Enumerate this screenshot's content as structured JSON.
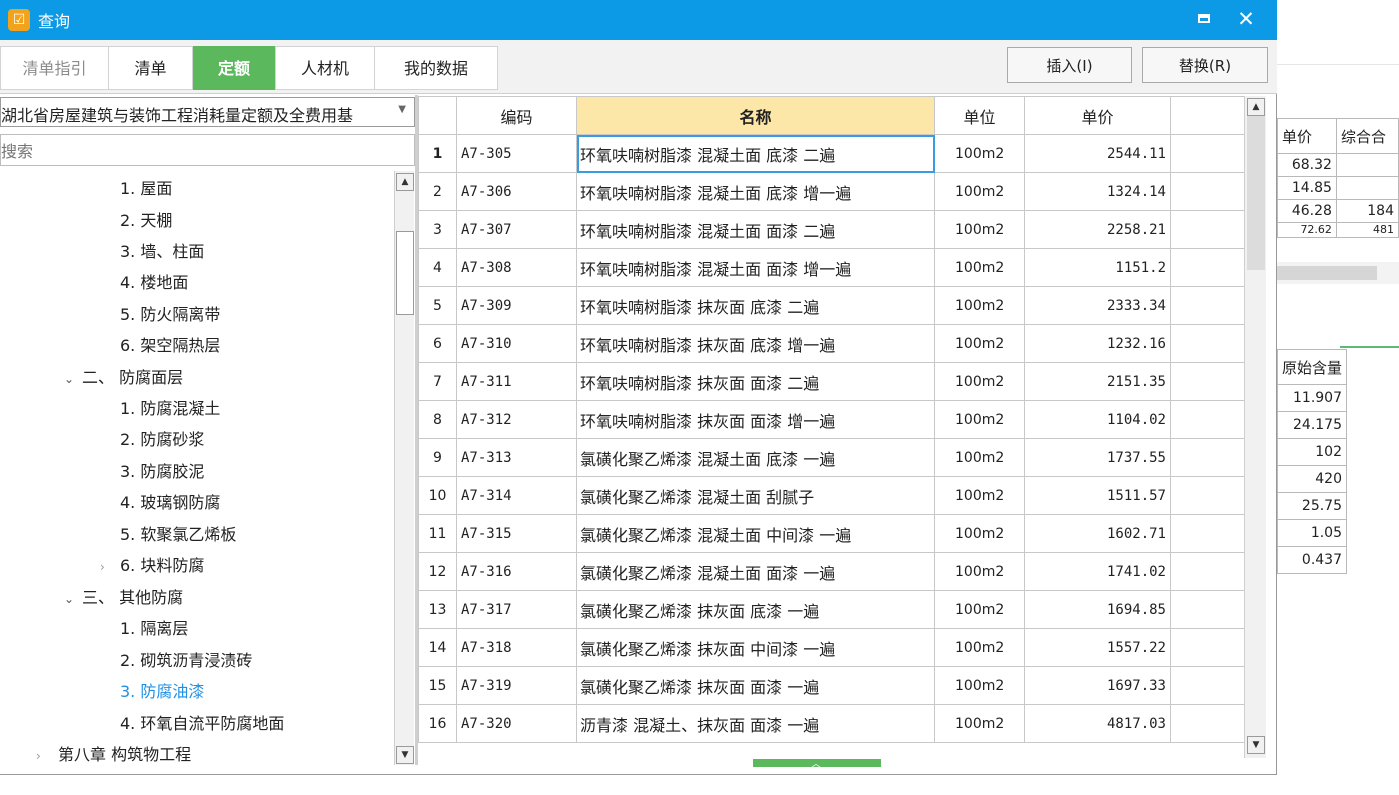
{
  "window": {
    "title": "查询",
    "app_icon_glyph": "☑"
  },
  "tabs": [
    {
      "label": "清单指引",
      "state": "dim"
    },
    {
      "label": "清单",
      "state": "normal"
    },
    {
      "label": "定额",
      "state": "active"
    },
    {
      "label": "人材机",
      "state": "normal"
    },
    {
      "label": "我的数据",
      "state": "normal"
    }
  ],
  "toolbar": {
    "insert_label": "插入(I)",
    "replace_label": "替换(R)"
  },
  "library": {
    "selected": "湖北省房屋建筑与装饰工程消耗量定额及全费用基"
  },
  "search": {
    "placeholder": "搜索"
  },
  "tree": [
    {
      "label": "1. 屋面",
      "arrow": ""
    },
    {
      "label": "2. 天棚",
      "arrow": ""
    },
    {
      "label": "3. 墙、柱面",
      "arrow": ""
    },
    {
      "label": "4. 楼地面",
      "arrow": ""
    },
    {
      "label": "5. 防火隔离带",
      "arrow": ""
    },
    {
      "label": "6. 架空隔热层",
      "arrow": ""
    },
    {
      "label": "二、 防腐面层",
      "arrow": "⌄"
    },
    {
      "label": "1. 防腐混凝土",
      "arrow": ""
    },
    {
      "label": "2. 防腐砂浆",
      "arrow": ""
    },
    {
      "label": "3. 防腐胶泥",
      "arrow": ""
    },
    {
      "label": "4. 玻璃钢防腐",
      "arrow": ""
    },
    {
      "label": "5. 软聚氯乙烯板",
      "arrow": ""
    },
    {
      "label": "6. 块料防腐",
      "arrow": "›"
    },
    {
      "label": "三、 其他防腐",
      "arrow": "⌄"
    },
    {
      "label": "1. 隔离层",
      "arrow": ""
    },
    {
      "label": "2. 砌筑沥青浸渍砖",
      "arrow": ""
    },
    {
      "label": "3. 防腐油漆",
      "arrow": "",
      "selected": true
    },
    {
      "label": "4. 环氧自流平防腐地面",
      "arrow": ""
    },
    {
      "label": "第八章 构筑物工程",
      "arrow": "›"
    }
  ],
  "grid": {
    "headers": {
      "code": "编码",
      "name": "名称",
      "unit": "单位",
      "price": "单价"
    },
    "rows": [
      {
        "no": "1",
        "code": "A7-305",
        "name": "环氧呋喃树脂漆 混凝土面 底漆 二遍",
        "unit": "100m2",
        "price": "2544.11"
      },
      {
        "no": "2",
        "code": "A7-306",
        "name": "环氧呋喃树脂漆 混凝土面 底漆 增一遍",
        "unit": "100m2",
        "price": "1324.14"
      },
      {
        "no": "3",
        "code": "A7-307",
        "name": "环氧呋喃树脂漆 混凝土面 面漆 二遍",
        "unit": "100m2",
        "price": "2258.21"
      },
      {
        "no": "4",
        "code": "A7-308",
        "name": "环氧呋喃树脂漆 混凝土面 面漆 增一遍",
        "unit": "100m2",
        "price": "1151.2"
      },
      {
        "no": "5",
        "code": "A7-309",
        "name": "环氧呋喃树脂漆 抹灰面 底漆 二遍",
        "unit": "100m2",
        "price": "2333.34"
      },
      {
        "no": "6",
        "code": "A7-310",
        "name": "环氧呋喃树脂漆 抹灰面 底漆 增一遍",
        "unit": "100m2",
        "price": "1232.16"
      },
      {
        "no": "7",
        "code": "A7-311",
        "name": "环氧呋喃树脂漆 抹灰面 面漆 二遍",
        "unit": "100m2",
        "price": "2151.35"
      },
      {
        "no": "8",
        "code": "A7-312",
        "name": "环氧呋喃树脂漆 抹灰面 面漆 增一遍",
        "unit": "100m2",
        "price": "1104.02"
      },
      {
        "no": "9",
        "code": "A7-313",
        "name": "氯磺化聚乙烯漆 混凝土面 底漆 一遍",
        "unit": "100m2",
        "price": "1737.55"
      },
      {
        "no": "10",
        "code": "A7-314",
        "name": "氯磺化聚乙烯漆 混凝土面 刮腻子",
        "unit": "100m2",
        "price": "1511.57"
      },
      {
        "no": "11",
        "code": "A7-315",
        "name": "氯磺化聚乙烯漆 混凝土面 中间漆 一遍",
        "unit": "100m2",
        "price": "1602.71"
      },
      {
        "no": "12",
        "code": "A7-316",
        "name": "氯磺化聚乙烯漆 混凝土面 面漆 一遍",
        "unit": "100m2",
        "price": "1741.02"
      },
      {
        "no": "13",
        "code": "A7-317",
        "name": "氯磺化聚乙烯漆 抹灰面 底漆 一遍",
        "unit": "100m2",
        "price": "1694.85"
      },
      {
        "no": "14",
        "code": "A7-318",
        "name": "氯磺化聚乙烯漆 抹灰面 中间漆 一遍",
        "unit": "100m2",
        "price": "1557.22"
      },
      {
        "no": "15",
        "code": "A7-319",
        "name": "氯磺化聚乙烯漆 抹灰面 面漆 一遍",
        "unit": "100m2",
        "price": "1697.33"
      },
      {
        "no": "16",
        "code": "A7-320",
        "name": "沥青漆 混凝土、抹灰面 面漆 一遍",
        "unit": "100m2",
        "price": "4817.03"
      }
    ]
  },
  "background_window": {
    "table1": {
      "headers": [
        "单价",
        "综合合"
      ],
      "rows": [
        [
          "68.32",
          ""
        ],
        [
          "14.85",
          ""
        ],
        [
          "46.28",
          "184"
        ],
        [
          "72.62",
          "481"
        ]
      ]
    },
    "table2": {
      "header": "原始含量",
      "values": [
        "11.907",
        "24.175",
        "102",
        "420",
        "25.75",
        "1.05",
        "0.437"
      ]
    }
  },
  "colors": {
    "titlebar": "#0c9ae6",
    "active_tab": "#5cb85c",
    "name_header": "#fde7a8",
    "selected_tree": "#1e90e6"
  }
}
